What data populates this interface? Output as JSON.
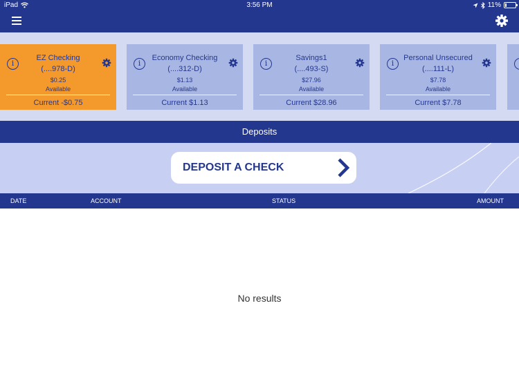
{
  "status_bar": {
    "device": "iPad",
    "time": "3:56 PM",
    "battery": "11%",
    "battery_level": 0.11
  },
  "header": {
    "menu_icon": "hamburger-menu-icon",
    "settings_icon": "gear-icon"
  },
  "accounts": [
    {
      "name": "EZ Checking",
      "number": "(....978-D)",
      "available_amount": "$0.25",
      "available_label": "Available",
      "current": "Current -$0.75",
      "selected": true
    },
    {
      "name": "Economy Checking",
      "number": "(....312-D)",
      "available_amount": "$1.13",
      "available_label": "Available",
      "current": "Current $1.13",
      "selected": false
    },
    {
      "name": "Savings1",
      "number": "(....493-S)",
      "available_amount": "$27.96",
      "available_label": "Available",
      "current": "Current $28.96",
      "selected": false
    },
    {
      "name": "Personal Unsecured",
      "number": "(....111-L)",
      "available_amount": "$7.78",
      "available_label": "Available",
      "current": "Current $7.78",
      "selected": false
    }
  ],
  "card_icons": {
    "info": "i"
  },
  "section": {
    "title": "Deposits"
  },
  "deposit": {
    "button_label": "DEPOSIT A CHECK"
  },
  "table": {
    "columns": {
      "date": "DATE",
      "account": "ACCOUNT",
      "status": "STATUS",
      "amount": "AMOUNT"
    },
    "empty_message": "No results"
  },
  "colors": {
    "brand_navy": "#24378f",
    "selected_card": "#f49a2d",
    "card": "#a8b6e4",
    "band": "#d5daf3"
  }
}
